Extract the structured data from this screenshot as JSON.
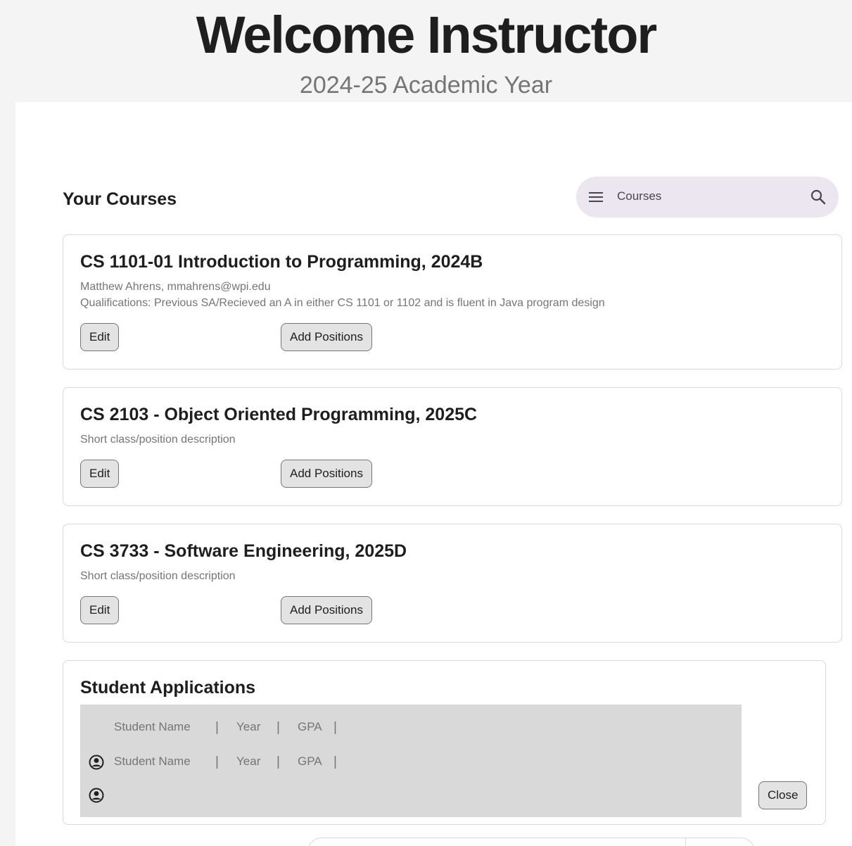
{
  "header": {
    "title": "Welcome Instructor",
    "subtitle": "2024-25 Academic Year"
  },
  "courses_section": {
    "title": "Your Courses",
    "search": {
      "placeholder": "Courses",
      "leading_icon": "menu-icon",
      "trailing_icon": "search-icon"
    }
  },
  "courses": [
    {
      "title": "CS 1101-01 Introduction to Programming, 2024B",
      "lines": [
        "Matthew Ahrens, mmahrens@wpi.edu",
        "Qualifications: Previous SA/Recieved an A in either CS 1101 or 1102 and is fluent in Java program design"
      ],
      "edit_label": "Edit",
      "add_label": "Add Positions"
    },
    {
      "title": "CS 2103 - Object Oriented Programming, 2025C",
      "lines": [
        "Short class/position description"
      ],
      "edit_label": "Edit",
      "add_label": "Add Positions"
    },
    {
      "title": "CS 3733 - Software Engineering, 2025D",
      "lines": [
        "Short class/position description"
      ],
      "edit_label": "Edit",
      "add_label": "Add Positions"
    }
  ],
  "applications": {
    "title": "Student Applications",
    "header_row": {
      "name": "Student Name",
      "year": "Year",
      "gpa": "GPA"
    },
    "rows": [
      {
        "name": "Student Name",
        "year": "Year",
        "gpa": "GPA",
        "icon": "account-circle-icon"
      },
      {
        "name": "",
        "year": "",
        "gpa": "",
        "icon": "account-circle-icon"
      }
    ],
    "separator": "|",
    "close_label": "Close"
  },
  "colors": {
    "background": "#f4f4f4",
    "surface": "#ffffff",
    "search_bg": "#ece6f0",
    "button_bg": "#e3e3e3",
    "table_bg": "#d9d9d9",
    "text_primary": "#1e1e1e",
    "text_secondary": "#757575"
  }
}
